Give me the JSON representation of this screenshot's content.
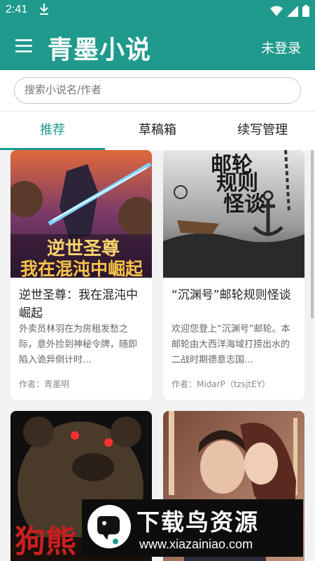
{
  "status_bar": {
    "time": "2:41",
    "download_icon": "download-icon",
    "icons": [
      "wifi-icon",
      "signal-icon",
      "battery-icon"
    ]
  },
  "app_bar": {
    "menu_icon": "hamburger-menu-icon",
    "title": "青墨小说",
    "login": "未登录",
    "color": "#1f9a8c"
  },
  "search": {
    "placeholder": "搜索小说名/作者"
  },
  "tabs": [
    {
      "label": "推荐",
      "active": true
    },
    {
      "label": "草稿箱",
      "active": false
    },
    {
      "label": "续写管理",
      "active": false
    }
  ],
  "books": [
    {
      "title": "逆世圣尊：我在混沌中崛起",
      "description": "外卖员林羽在为房租发愁之际，意外捡到神秘令牌，随即陷入诡异倒计时…",
      "author": "作者：青墨明",
      "cover_text": [
        "逆世圣尊",
        "我在混沌中崛起"
      ]
    },
    {
      "title": "“沉渊号”邮轮规则怪谈",
      "description": "欢迎您登上“沉渊号”邮轮。本邮轮由大西洋海域打捞出水的二战时期德意志国…",
      "author": "作者：MidarP（tzsjtEY）",
      "cover_text": [
        "邮轮",
        "规则",
        "怪谈"
      ]
    },
    {
      "title": "",
      "description": "",
      "author": "",
      "cover_text": [
        "狗熊"
      ]
    },
    {
      "title": "",
      "description": "",
      "author": "",
      "cover_text": []
    }
  ],
  "watermark": {
    "title": "下载鸟资源",
    "url": "www.xiazainiao.com"
  }
}
